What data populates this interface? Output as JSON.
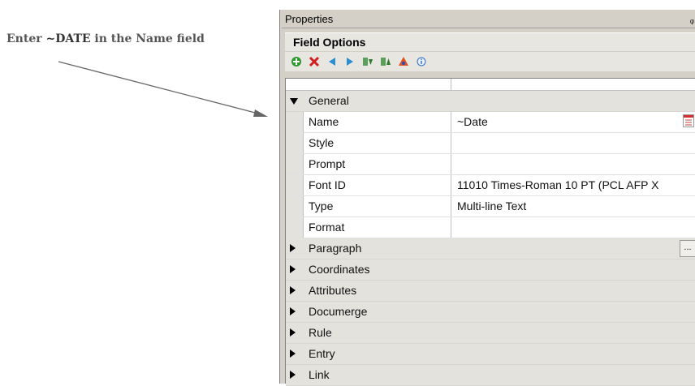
{
  "callout": {
    "prefix": "Enter ",
    "code": "~DATE",
    "suffix": " in the Name field"
  },
  "panel": {
    "title": "Properties",
    "pin_glyph": "ᵩ",
    "section_title": "Field Options",
    "toolbar": [
      {
        "icon": "add-icon",
        "color": "#2e9a2e"
      },
      {
        "icon": "delete-icon",
        "color": "#d02020"
      },
      {
        "icon": "move-left-icon",
        "color": "#2a8fd0"
      },
      {
        "icon": "move-right-icon",
        "color": "#2a8fd0"
      },
      {
        "icon": "move-down-icon",
        "color": "#3a9a3a"
      },
      {
        "icon": "move-up-icon",
        "color": "#3a9a3a"
      },
      {
        "icon": "properties-icon",
        "color": "#c04020"
      },
      {
        "icon": "info-icon",
        "color": "#3070c0"
      }
    ]
  },
  "general": {
    "label": "General",
    "props": [
      {
        "name": "Name",
        "value": "~Date"
      },
      {
        "name": "Style",
        "value": ""
      },
      {
        "name": "Prompt",
        "value": ""
      },
      {
        "name": "Font ID",
        "value": "11010 Times-Roman 10 PT (PCL AFP X"
      },
      {
        "name": "Type",
        "value": "Multi-line Text"
      },
      {
        "name": "Format",
        "value": ""
      }
    ]
  },
  "categories": [
    "Paragraph",
    "Coordinates",
    "Attributes",
    "Documerge",
    "Rule",
    "Entry",
    "Link"
  ],
  "ellipsis_label": "..."
}
